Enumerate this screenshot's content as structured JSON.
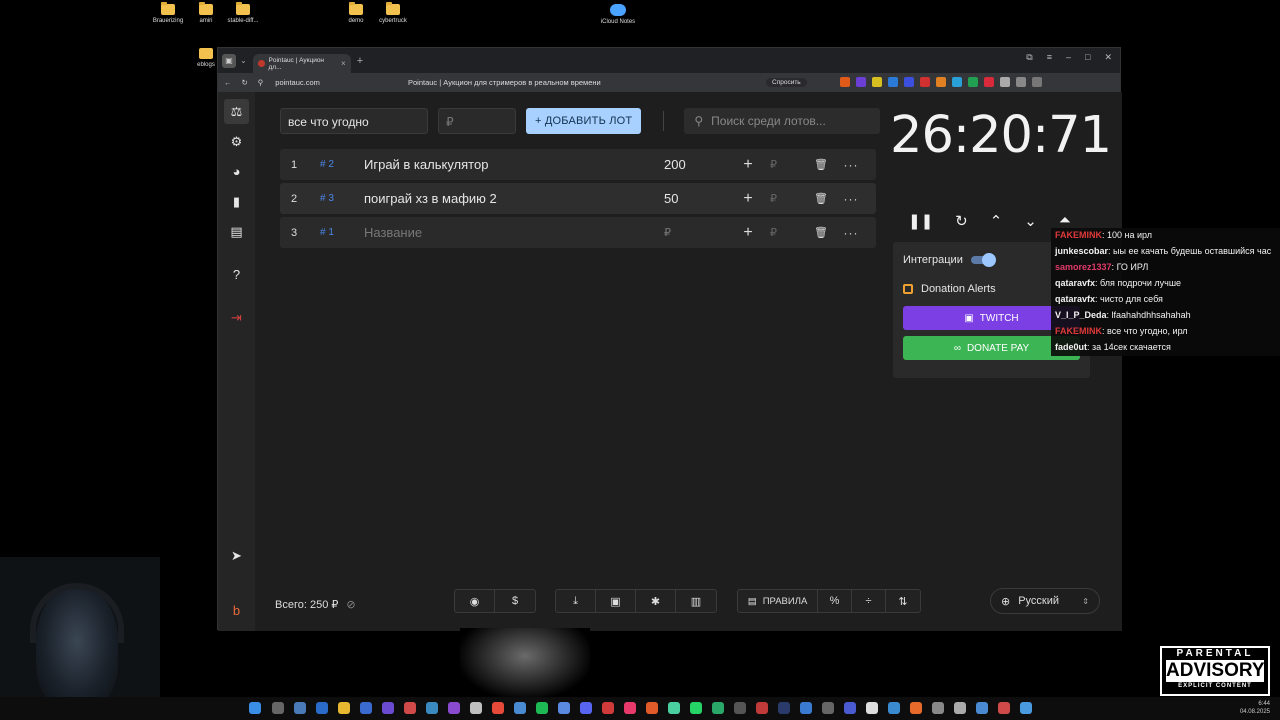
{
  "desktop": {
    "icons": [
      "Brauerizing",
      "amiri",
      "stable-diff...",
      "demo",
      "cybertruck"
    ],
    "icloud": "iCloud Notes",
    "side_folder": "eblogs"
  },
  "browser": {
    "tab_title": "Pointauc | Аукцион дл...",
    "url": "pointauc.com",
    "page_title": "Pointauc | Аукцион для стримеров в реальном времени",
    "ask_label": "Спросить"
  },
  "form": {
    "name_value": "все что угодно",
    "amount_placeholder": "₽",
    "add_button": "ДОБАВИТЬ ЛОТ",
    "search_placeholder": "Поиск среди лотов..."
  },
  "lots": [
    {
      "num": "1",
      "id": "# 2",
      "name": "Играй в калькулятор",
      "amount": "200",
      "rub": "₽"
    },
    {
      "num": "2",
      "id": "# 3",
      "name": "поиграй хз в мафию 2",
      "amount": "50",
      "rub": "₽"
    },
    {
      "num": "3",
      "id": "# 1",
      "name": "Название",
      "amount": "₽",
      "rub": "₽"
    }
  ],
  "timer": "26:20:71",
  "integrations": {
    "label": "Интеграции",
    "donation_alerts": "Donation Alerts",
    "twitch": "TWITCH",
    "donate_pay": "DONATE PAY"
  },
  "footer": {
    "total": "Всего: 250 ₽",
    "rules": "ПРАВИЛА",
    "language": "Русский"
  },
  "chat": [
    {
      "user": "FAKEMINK",
      "color": "#e03a3a",
      "text": "100 на ирл"
    },
    {
      "user": "junkescobar",
      "color": "#e6e6e6",
      "text": "ыы ее качать будешь оставшийся час"
    },
    {
      "user": "samorez1337",
      "color": "#e03a6a",
      "text": "ГО ИРЛ"
    },
    {
      "user": "qataravfx",
      "color": "#e6e6e6",
      "text": "бля подрочи лучше"
    },
    {
      "user": "qataravfx",
      "color": "#e6e6e6",
      "text": "чисто для себя"
    },
    {
      "user": "V_I_P_Deda",
      "color": "#e6e6e6",
      "text": "lfaahahdhhsahahah"
    },
    {
      "user": "FAKEMINK",
      "color": "#e03a3a",
      "text": "все что угодно, ирл"
    },
    {
      "user": "fade0ut",
      "color": "#e6e6e6",
      "text": "за 14сек скачается"
    }
  ],
  "advisory": {
    "line1": "PARENTAL",
    "line2": "ADVISORY",
    "line3": "EXPLICIT CONTENT"
  },
  "clock": {
    "time": "6:44",
    "date": "04.08.2025"
  }
}
